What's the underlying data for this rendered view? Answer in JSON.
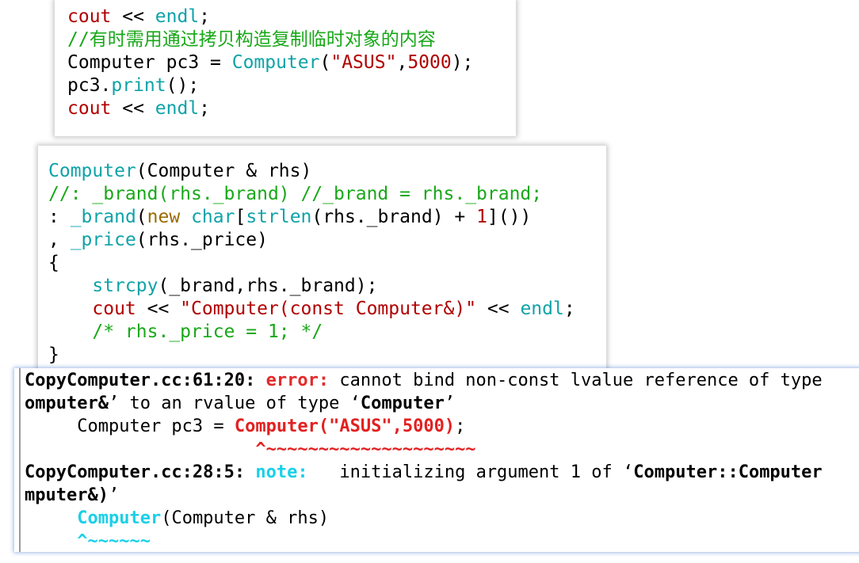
{
  "top_snippet": {
    "l1": [
      "cout",
      " << ",
      "endl",
      ";"
    ],
    "l2": "//有时需用通过拷贝构造复制临时对象的内容",
    "l3": [
      "Computer pc3 = ",
      "Computer",
      "(",
      "\"ASUS\"",
      ",",
      "5000",
      ");"
    ],
    "l4": [
      "pc3.",
      "print",
      "();"
    ],
    "l5": [
      "cout",
      " << ",
      "endl",
      ";"
    ]
  },
  "middle_snippet": {
    "l1": [
      "Computer",
      "(Computer & rhs)"
    ],
    "l2": "//: _brand(rhs._brand) //_brand = rhs._brand;",
    "l3": [
      ": ",
      "_brand",
      "(",
      "new",
      " ",
      "char",
      "[",
      "strlen",
      "(rhs._brand) + ",
      "1",
      "]())"
    ],
    "l4": [
      ", ",
      "_price",
      "(rhs._price)"
    ],
    "l5": "{",
    "l6": [
      "    ",
      "strcpy",
      "(_brand,rhs._brand);"
    ],
    "l7": [
      "    ",
      "cout",
      " << ",
      "\"Computer(const Computer&)\"",
      " << ",
      "endl",
      ";"
    ],
    "l8": [
      "    ",
      "/* rhs._price = 1; */"
    ],
    "l9": "}"
  },
  "terminal": {
    "l1": [
      "CopyComputer.cc:61:20: ",
      "error:",
      " cannot bind non-const lvalue reference of type"
    ],
    "l2": [
      "omputer&",
      "’ to an rvalue of type ‘",
      "Computer",
      "’"
    ],
    "l3": [
      "     Computer pc3 = ",
      "Computer(\"ASUS\",5000)",
      ";"
    ],
    "l4": [
      "                      ",
      "^~~~~~~~~~~~~~~~~~~~~"
    ],
    "l5": [
      "CopyComputer.cc:28:5: ",
      "note:",
      "   initializing argument 1 of ‘",
      "Computer::Computer"
    ],
    "l6": [
      "mputer&)",
      "’"
    ],
    "l7": [
      "     ",
      "Computer",
      "(Computer & rhs)"
    ],
    "l8": [
      "     ",
      "^~~~~~~"
    ]
  }
}
